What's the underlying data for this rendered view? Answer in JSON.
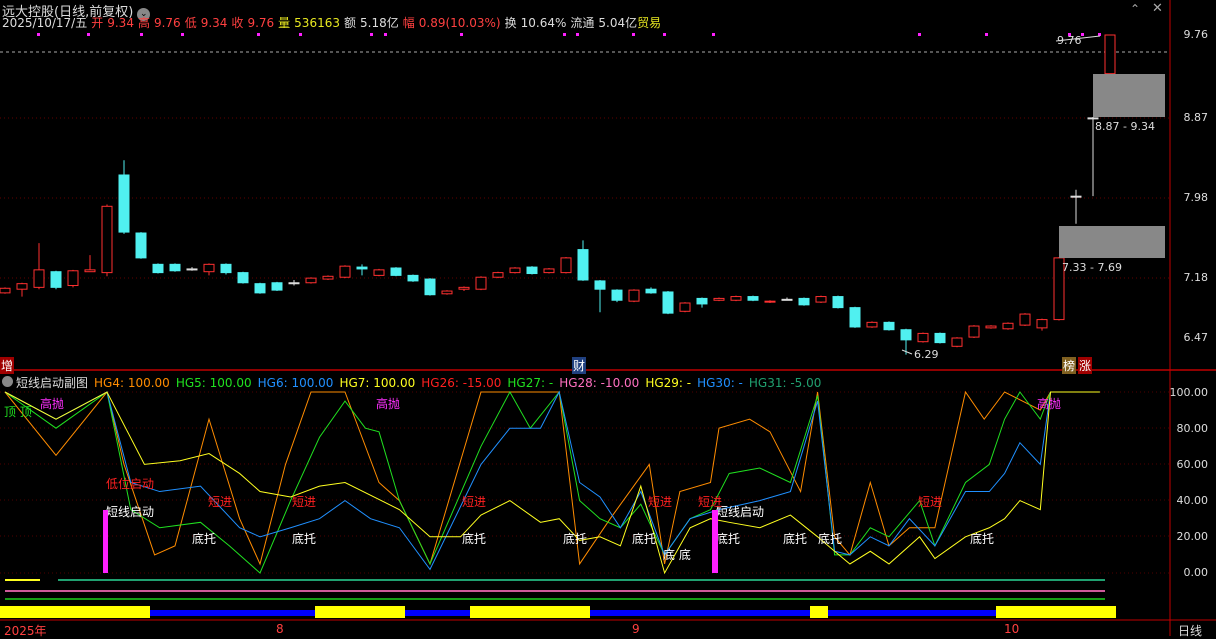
{
  "header": {
    "title": "远大控股(日线,前复权)",
    "date": "2025/10/17/五",
    "fields": [
      {
        "k": "开",
        "v": "9.34",
        "c": "r"
      },
      {
        "k": "高",
        "v": "9.76",
        "c": "r"
      },
      {
        "k": "低",
        "v": "9.34",
        "c": "r"
      },
      {
        "k": "收",
        "v": "9.76",
        "c": "r"
      },
      {
        "k": "量",
        "v": "536163",
        "c": "y"
      },
      {
        "k": "额",
        "v": "5.18亿",
        "c": "w"
      },
      {
        "k": "幅",
        "v": "0.89(10.03%)",
        "c": "r"
      },
      {
        "k": "换",
        "v": "10.64%",
        "c": "w"
      },
      {
        "k": "流通",
        "v": "5.04亿",
        "c": "w"
      }
    ],
    "sector": "贸易"
  },
  "colors": {
    "up": "#ff3030",
    "down": "#50f0f0",
    "bg": "#000000",
    "grid": "#8b0000"
  },
  "price_axis": [
    "9.76",
    "8.87",
    "7.98",
    "7.18",
    "6.47"
  ],
  "annotations": {
    "high": "9.76",
    "low": "6.29",
    "zone_upper": "8.87 - 9.34",
    "zone_lower": "7.33 - 7.69"
  },
  "markers": [
    "增",
    "财",
    "榜",
    "涨"
  ],
  "indicator": {
    "title": "短线启动副图",
    "values": [
      {
        "t": "HG4: 100.00",
        "c": "#ff8c00"
      },
      {
        "t": "HG5: 100.00",
        "c": "#20e020"
      },
      {
        "t": "HG6: 100.00",
        "c": "#2090ff"
      },
      {
        "t": "HG7: 100.00",
        "c": "#ffff20"
      },
      {
        "t": "HG26: -15.00",
        "c": "#ff2020"
      },
      {
        "t": "HG27: -",
        "c": "#20e020"
      },
      {
        "t": "HG28: -10.00",
        "c": "#ff70c0"
      },
      {
        "t": "HG29: -",
        "c": "#ffff20"
      },
      {
        "t": "HG30: -",
        "c": "#2090ff"
      },
      {
        "t": "HG31: -5.00",
        "c": "#20a070"
      }
    ],
    "axis": [
      "100.00",
      "80.00",
      "60.00",
      "40.00",
      "20.00",
      "0.00"
    ],
    "signals": {
      "top": "顶 顶",
      "sell": "高抛",
      "low_start": "低位启动",
      "short_start": "短线启动",
      "short_in": "短进",
      "support": "底托",
      "bottom": "底 底"
    }
  },
  "time_axis": [
    "2025年",
    "8",
    "9",
    "10",
    "日线"
  ],
  "chart_data": {
    "type": "candlestick",
    "ylim": [
      6.29,
      9.76
    ],
    "candles_ochl": [
      [
        6.96,
        7.01,
        7.02,
        6.95
      ],
      [
        7.0,
        7.06,
        7.07,
        6.92
      ],
      [
        7.02,
        7.21,
        7.5,
        7.0
      ],
      [
        7.19,
        7.02,
        7.2,
        7.0
      ],
      [
        7.04,
        7.2,
        7.21,
        7.02
      ],
      [
        7.19,
        7.21,
        7.37,
        7.19
      ],
      [
        7.18,
        7.9,
        7.92,
        7.14
      ],
      [
        8.24,
        7.62,
        8.4,
        7.6
      ],
      [
        7.61,
        7.34,
        7.62,
        7.33
      ],
      [
        7.27,
        7.18,
        7.28,
        7.17
      ],
      [
        7.27,
        7.2,
        7.28,
        7.19
      ],
      [
        7.22,
        7.22,
        7.24,
        7.2
      ],
      [
        7.19,
        7.27,
        7.28,
        7.15
      ],
      [
        7.27,
        7.18,
        7.28,
        7.16
      ],
      [
        7.18,
        7.07,
        7.19,
        7.06
      ],
      [
        7.06,
        6.96,
        7.07,
        6.95
      ],
      [
        7.07,
        6.99,
        7.08,
        6.98
      ],
      [
        7.07,
        7.07,
        7.1,
        7.04
      ],
      [
        7.07,
        7.12,
        7.13,
        7.06
      ],
      [
        7.11,
        7.14,
        7.15,
        7.1
      ],
      [
        7.13,
        7.25,
        7.26,
        7.12
      ],
      [
        7.24,
        7.22,
        7.27,
        7.15
      ],
      [
        7.15,
        7.21,
        7.22,
        7.14
      ],
      [
        7.23,
        7.15,
        7.24,
        7.14
      ],
      [
        7.15,
        7.09,
        7.16,
        7.08
      ],
      [
        7.11,
        6.94,
        7.12,
        6.93
      ],
      [
        6.95,
        6.98,
        6.99,
        6.94
      ],
      [
        7.0,
        7.02,
        7.03,
        6.98
      ],
      [
        7.0,
        7.13,
        7.14,
        6.99
      ],
      [
        7.13,
        7.18,
        7.19,
        7.12
      ],
      [
        7.18,
        7.23,
        7.24,
        7.17
      ],
      [
        7.24,
        7.17,
        7.25,
        7.16
      ],
      [
        7.18,
        7.22,
        7.23,
        7.17
      ],
      [
        7.18,
        7.34,
        7.35,
        7.17
      ],
      [
        7.43,
        7.1,
        7.53,
        7.09
      ],
      [
        7.09,
        7.0,
        7.1,
        6.75
      ],
      [
        6.99,
        6.88,
        7.0,
        6.86
      ],
      [
        6.87,
        6.99,
        7.0,
        6.86
      ],
      [
        7.0,
        6.96,
        7.02,
        6.95
      ],
      [
        6.97,
        6.74,
        6.98,
        6.73
      ],
      [
        6.76,
        6.85,
        6.86,
        6.75
      ],
      [
        6.9,
        6.84,
        6.91,
        6.8
      ],
      [
        6.88,
        6.9,
        6.91,
        6.87
      ],
      [
        6.88,
        6.92,
        6.93,
        6.87
      ],
      [
        6.92,
        6.88,
        6.93,
        6.87
      ],
      [
        6.86,
        6.87,
        6.88,
        6.85
      ],
      [
        6.89,
        6.89,
        6.91,
        6.88
      ],
      [
        6.9,
        6.83,
        6.91,
        6.82
      ],
      [
        6.86,
        6.92,
        6.93,
        6.85
      ],
      [
        6.92,
        6.8,
        6.93,
        6.79
      ],
      [
        6.8,
        6.59,
        6.81,
        6.58
      ],
      [
        6.59,
        6.64,
        6.65,
        6.58
      ],
      [
        6.64,
        6.56,
        6.65,
        6.55
      ],
      [
        6.56,
        6.45,
        6.57,
        6.29
      ],
      [
        6.43,
        6.52,
        6.53,
        6.42
      ],
      [
        6.52,
        6.42,
        6.53,
        6.41
      ],
      [
        6.38,
        6.47,
        6.48,
        6.37
      ],
      [
        6.48,
        6.6,
        6.61,
        6.47
      ],
      [
        6.58,
        6.6,
        6.61,
        6.57
      ],
      [
        6.57,
        6.63,
        6.64,
        6.56
      ],
      [
        6.61,
        6.73,
        6.74,
        6.6
      ],
      [
        6.58,
        6.67,
        6.68,
        6.55
      ],
      [
        6.67,
        7.34,
        7.35,
        6.66
      ],
      [
        8.01,
        8.01,
        8.08,
        7.71
      ],
      [
        8.86,
        8.86,
        8.87,
        8.01
      ],
      [
        9.34,
        9.76,
        9.76,
        9.34
      ]
    ],
    "indicator_series": [
      {
        "name": "HG4",
        "color": "#ff8c00",
        "points": [
          [
            0,
            100
          ],
          [
            3,
            65
          ],
          [
            6,
            100
          ],
          [
            7,
            60
          ],
          [
            8.8,
            10
          ],
          [
            10,
            15
          ],
          [
            12,
            85
          ],
          [
            13.8,
            30
          ],
          [
            15,
            5
          ],
          [
            16.5,
            60
          ],
          [
            18,
            100
          ],
          [
            20,
            100
          ],
          [
            22,
            50
          ],
          [
            23.2,
            40
          ],
          [
            25,
            5
          ],
          [
            28,
            100
          ],
          [
            29.7,
            100
          ],
          [
            32.6,
            100
          ],
          [
            33.8,
            5
          ],
          [
            35.6,
            30
          ],
          [
            37.9,
            60
          ],
          [
            38.8,
            5
          ],
          [
            39.7,
            45
          ],
          [
            41.5,
            50
          ],
          [
            42,
            80
          ],
          [
            43.8,
            85
          ],
          [
            45,
            78
          ],
          [
            46.8,
            45
          ],
          [
            47.8,
            100
          ],
          [
            48.8,
            20
          ],
          [
            49.7,
            10
          ],
          [
            50.9,
            50
          ],
          [
            52,
            15
          ],
          [
            53.2,
            25
          ],
          [
            54.7,
            25
          ],
          [
            56.5,
            100
          ],
          [
            57.6,
            85
          ],
          [
            58.8,
            100
          ],
          [
            60.9,
            90
          ],
          [
            61.5,
            100
          ],
          [
            64.4,
            100
          ]
        ]
      },
      {
        "name": "HG5",
        "color": "#20e020",
        "points": [
          [
            0,
            100
          ],
          [
            3,
            80
          ],
          [
            6,
            100
          ],
          [
            7.4,
            35
          ],
          [
            9.1,
            25
          ],
          [
            11.5,
            28
          ],
          [
            13.2,
            15
          ],
          [
            15,
            0
          ],
          [
            16.8,
            40
          ],
          [
            18.5,
            75
          ],
          [
            20,
            95
          ],
          [
            21.2,
            80
          ],
          [
            22,
            78
          ],
          [
            23.2,
            40
          ],
          [
            25,
            5
          ],
          [
            28,
            70
          ],
          [
            29.7,
            100
          ],
          [
            30.9,
            80
          ],
          [
            32.6,
            100
          ],
          [
            33.8,
            40
          ],
          [
            35,
            30
          ],
          [
            36.2,
            25
          ],
          [
            37.4,
            38
          ],
          [
            38.8,
            10
          ],
          [
            40.3,
            30
          ],
          [
            41.5,
            35
          ],
          [
            42.6,
            55
          ],
          [
            44.4,
            58
          ],
          [
            46.2,
            50
          ],
          [
            47.8,
            98
          ],
          [
            48.8,
            10
          ],
          [
            49.7,
            10
          ],
          [
            50.9,
            25
          ],
          [
            52,
            20
          ],
          [
            53.8,
            40
          ],
          [
            54.7,
            15
          ],
          [
            56.5,
            50
          ],
          [
            57.9,
            60
          ],
          [
            58.8,
            85
          ],
          [
            59.7,
            100
          ],
          [
            60.9,
            85
          ],
          [
            61.5,
            100
          ],
          [
            64.4,
            100
          ]
        ]
      },
      {
        "name": "HG6",
        "color": "#2090ff",
        "points": [
          [
            0,
            100
          ],
          [
            3,
            85
          ],
          [
            6,
            100
          ],
          [
            7.4,
            50
          ],
          [
            9.1,
            45
          ],
          [
            11.5,
            48
          ],
          [
            13.8,
            25
          ],
          [
            15,
            20
          ],
          [
            16.8,
            25
          ],
          [
            18.5,
            30
          ],
          [
            20,
            40
          ],
          [
            21.5,
            30
          ],
          [
            23.2,
            25
          ],
          [
            25,
            2
          ],
          [
            28,
            60
          ],
          [
            29.7,
            80
          ],
          [
            31.5,
            80
          ],
          [
            32.6,
            100
          ],
          [
            33.8,
            50
          ],
          [
            35,
            42
          ],
          [
            36.2,
            25
          ],
          [
            37.4,
            45
          ],
          [
            38.8,
            10
          ],
          [
            40.3,
            30
          ],
          [
            42,
            35
          ],
          [
            44.4,
            40
          ],
          [
            46.2,
            45
          ],
          [
            47.8,
            95
          ],
          [
            48.8,
            12
          ],
          [
            49.7,
            10
          ],
          [
            50.9,
            20
          ],
          [
            52,
            15
          ],
          [
            53.2,
            30
          ],
          [
            54.7,
            15
          ],
          [
            56.5,
            45
          ],
          [
            57.9,
            45
          ],
          [
            58.8,
            55
          ],
          [
            59.7,
            72
          ],
          [
            60.9,
            60
          ],
          [
            61.5,
            100
          ],
          [
            64.4,
            100
          ]
        ]
      },
      {
        "name": "HG7",
        "color": "#ffff20",
        "points": [
          [
            0,
            100
          ],
          [
            3,
            85
          ],
          [
            6,
            100
          ],
          [
            8.2,
            60
          ],
          [
            10.3,
            62
          ],
          [
            12,
            66
          ],
          [
            13.8,
            55
          ],
          [
            15,
            45
          ],
          [
            16.8,
            42
          ],
          [
            18.5,
            48
          ],
          [
            20,
            50
          ],
          [
            23.2,
            35
          ],
          [
            25,
            20
          ],
          [
            26.8,
            20
          ],
          [
            28,
            32
          ],
          [
            29.7,
            40
          ],
          [
            31.5,
            28
          ],
          [
            32.6,
            30
          ],
          [
            33.8,
            18
          ],
          [
            35,
            20
          ],
          [
            36.2,
            15
          ],
          [
            37.4,
            48
          ],
          [
            38.8,
            0
          ],
          [
            40.3,
            25
          ],
          [
            41.5,
            30
          ],
          [
            42.6,
            28
          ],
          [
            44.4,
            25
          ],
          [
            46.2,
            32
          ],
          [
            47.8,
            20
          ],
          [
            48.8,
            12
          ],
          [
            49.7,
            5
          ],
          [
            50.9,
            12
          ],
          [
            52,
            5
          ],
          [
            53.8,
            20
          ],
          [
            54.7,
            8
          ],
          [
            56.5,
            20
          ],
          [
            57.9,
            25
          ],
          [
            58.8,
            30
          ],
          [
            59.7,
            40
          ],
          [
            60.9,
            35
          ],
          [
            61.5,
            100
          ],
          [
            64.4,
            100
          ]
        ]
      }
    ]
  }
}
